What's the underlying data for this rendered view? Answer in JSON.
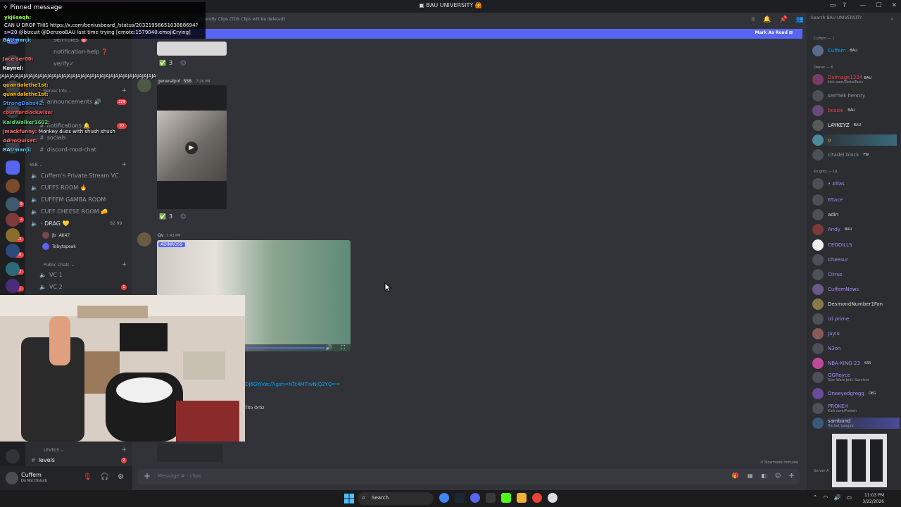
{
  "window": {
    "title": "BAU UNIVERSITY",
    "title_emoji": "🙆"
  },
  "stream_overlay": {
    "pinned_header": "Pinned message",
    "pinned_user": "ykj6seqh:",
    "pinned_text": "CAN U DROP THIS https://x.com/beniusbeard_/status/2032195665103888694?s=20 @bizcuit @DenzooBAU last time trying [emote:1579040:emojiCrying]",
    "chat": [
      {
        "user": "BAUmanji:",
        "msg": "",
        "color": "#5fd3ff"
      },
      {
        "user": "Jaceiser00:",
        "msg": "",
        "color": "#ff6a6a"
      },
      {
        "user": "Kaynel:",
        "msg": "",
        "color": "#ffffff"
      },
      {
        "user": "",
        "msg": "JAJAJAJAJAJAJAJAJAJAJAJAJAJAJAJAJAJAJAJAJAJAJAJAJAJAJAJAJAJAJAJAJA",
        "color": "#ffffff"
      },
      {
        "user": "quandalethe1st:",
        "msg": "",
        "color": "#ffb300"
      },
      {
        "user": "quandalethe1st:",
        "msg": "",
        "color": "#ffb300"
      },
      {
        "user": "StrongDabs42:",
        "msg": "",
        "color": "#2f8bff"
      },
      {
        "user": "counterclockwise:",
        "msg": "",
        "color": "#ff4d4d"
      },
      {
        "user": "KaidWalker1602:",
        "msg": "",
        "color": "#5fd36a"
      },
      {
        "user": "jmackfunny:",
        "msg": "Monkey duos with shush shush",
        "color": "#ff6a6a"
      },
      {
        "user": "AdnoQuiset:",
        "msg": "",
        "color": "#ff6a6a"
      },
      {
        "user": "BAUmanji:",
        "msg": "",
        "color": "#5fd3ff"
      }
    ]
  },
  "rail": {
    "badges": [
      "129",
      "5K+",
      "63",
      "40",
      "32",
      "41"
    ]
  },
  "channels": {
    "top_items": [
      {
        "label": "self-roles",
        "emoji": "🎯"
      },
      {
        "label": "notification-help",
        "emoji": "❓"
      },
      {
        "label": "verify✓",
        "emoji": ""
      }
    ],
    "server_info_cat": "Server Info",
    "announcements": "announcements",
    "announcements_badge": "229",
    "notifications": "notifications",
    "notifications_badge": "93",
    "socials": "socials",
    "discord_mod_chat": "discord-mod-chat",
    "ssb_cat": "SSB",
    "voice": [
      "Cuffem's Private Stream VC",
      "CUFFS ROOM",
      "CUFFEM GAMBA ROOM",
      "CUFF CHEESE ROOM"
    ],
    "drag": "DRAG",
    "drag_count": "02",
    "drag_limit": "99",
    "drag_users": [
      {
        "name": "Jb",
        "tag": "AK47"
      },
      {
        "name": "Tobytspeak",
        "tag": ""
      }
    ],
    "public_cat": "Public Chats",
    "vc1": "VC 1",
    "vc2": "VC 2",
    "vc2_badge": "1",
    "levels_cat": "LEVELS",
    "levels": "levels",
    "levels_badge": "2"
  },
  "user_panel": {
    "name": "Cuffem",
    "status": "Do Not Disturb"
  },
  "chat": {
    "channel_topic": "Friendly Clips (TOS Clips will be deleted)",
    "mark_as_read": "Mark As Read",
    "reaction1": "3",
    "reaction2": "3",
    "msg2_user": "generalpot",
    "msg2_tag": "SSB",
    "msg2_time": "7:26 PM",
    "msg3_user": "Qv",
    "msg3_time": "7:43 PM",
    "video2_channel": "ADINROSS",
    "link_text": "DJ6GYjVzc/?igsh=NTc4MTlwNjQ2YQ==",
    "mention_text": "Tito Ortiz",
    "composer_placeholder": "Message # · clips",
    "slowmode": "Slowmode Immune"
  },
  "members": {
    "search_placeholder": "Search BAU UNIVERSITY",
    "groups": [
      {
        "label": "Cuffem — 1",
        "members": [
          {
            "name": "Cuffem",
            "color": "#00a8fc",
            "tag": "BAU",
            "sub": ""
          }
        ]
      },
      {
        "label": "Owner — 6",
        "members": [
          {
            "name": "Dalmage1234",
            "color": "#f23f43",
            "tag": "BAU",
            "sub": "kick.com/TashaToxic"
          },
          {
            "name": "serrhek hennry",
            "color": "#949ba4",
            "tag": "",
            "sub": ""
          },
          {
            "name": "bossie",
            "color": "#f23f43",
            "tag": "BAU",
            "sub": ""
          },
          {
            "name": "LAYKEYZ",
            "color": "#ffffff",
            "tag": "BAU",
            "sub": ""
          },
          {
            "name": "o",
            "color": "#f0b232",
            "tag": "",
            "sub": ""
          },
          {
            "name": "citadel.block",
            "color": "#949ba4",
            "tag": "FW",
            "sub": ""
          }
        ]
      },
      {
        "label": "Knights — 19",
        "members": [
          {
            "name": "• zillas",
            "color": "#a78bfa",
            "tag": "",
            "sub": ""
          },
          {
            "name": "65ace",
            "color": "#a78bfa",
            "tag": "",
            "sub": ""
          },
          {
            "name": "adin",
            "color": "#dbdee1",
            "tag": "",
            "sub": ""
          },
          {
            "name": "Andy",
            "color": "#a78bfa",
            "tag": "BAU",
            "sub": ""
          },
          {
            "name": "CEODILLS",
            "color": "#a78bfa",
            "tag": "",
            "sub": ""
          },
          {
            "name": "Cheesur",
            "color": "#a78bfa",
            "tag": "",
            "sub": ""
          },
          {
            "name": "Citrus",
            "color": "#a78bfa",
            "tag": "",
            "sub": ""
          },
          {
            "name": "CuffemNews",
            "color": "#a78bfa",
            "tag": "",
            "sub": ""
          },
          {
            "name": "DesmondNumber1Fan",
            "color": "#dbdee1",
            "tag": "",
            "sub": ""
          },
          {
            "name": "izi prime",
            "color": "#a78bfa",
            "tag": "",
            "sub": ""
          },
          {
            "name": "Jaylo",
            "color": "#a78bfa",
            "tag": "",
            "sub": ""
          },
          {
            "name": "N3on",
            "color": "#a78bfa",
            "tag": "",
            "sub": ""
          },
          {
            "name": "NBA-KING-23",
            "color": "#a78bfa",
            "tag": "SSS",
            "sub": ""
          },
          {
            "name": "OGRoyce",
            "color": "#a78bfa",
            "tag": "",
            "sub": "Star Wars Jedi: Survivor"
          },
          {
            "name": "Oneeyedgregg",
            "color": "#a78bfa",
            "tag": "OEG",
            "sub": ""
          },
          {
            "name": "PROKEH",
            "color": "#a78bfa",
            "tag": "",
            "sub": "Kick.com/Prokeh"
          },
          {
            "name": "sambond",
            "color": "#dbdee1",
            "tag": "",
            "sub": "Rocket League"
          },
          {
            "name": "Server A",
            "color": "#949ba4",
            "tag": "",
            "sub": ""
          }
        ]
      }
    ]
  },
  "taskbar": {
    "search": "Search",
    "time": "11:03 PM",
    "date": "3/22/2026"
  },
  "colors": {
    "blurple": "#5865f2",
    "chat_bg": "#313338",
    "sidebar_bg": "#2b2d31",
    "rail_bg": "#1e1f22",
    "link": "#00a8fc",
    "dnd_red": "#f23f43",
    "online_green": "#23a55a"
  }
}
